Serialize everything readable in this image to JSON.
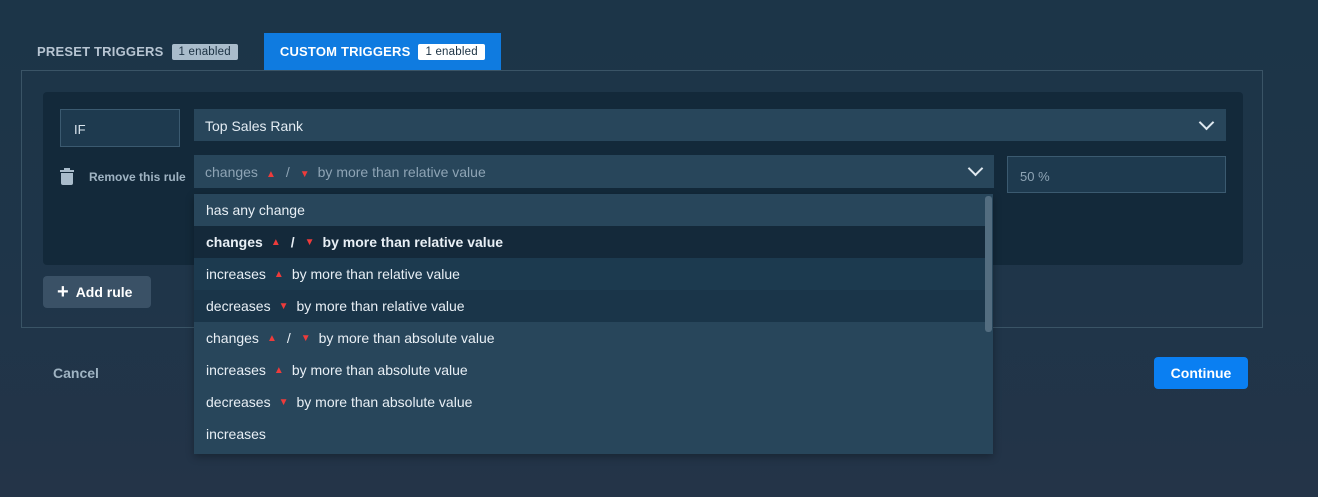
{
  "tabs": [
    {
      "label": "PRESET TRIGGERS",
      "badge": "1 enabled"
    },
    {
      "label": "CUSTOM TRIGGERS",
      "badge": "1 enabled"
    }
  ],
  "rule": {
    "if_label": "IF",
    "attribute": "Top Sales Rank",
    "condition": {
      "pre": "changes",
      "sep": "/",
      "post": "by more than relative value"
    },
    "value": "50 %",
    "remove_label": "Remove this rule"
  },
  "dropdown": {
    "options": [
      {
        "pre": "has any change",
        "sep": "",
        "post": ""
      },
      {
        "pre": "changes",
        "sep": "/",
        "post": "by more than relative value"
      },
      {
        "pre": "increases",
        "sep": "",
        "post": "by more than relative value"
      },
      {
        "pre": "decreases",
        "sep": "",
        "post": "by more than relative value"
      },
      {
        "pre": "changes",
        "sep": "/",
        "post": "by more than absolute value"
      },
      {
        "pre": "increases",
        "sep": "",
        "post": "by more than absolute value"
      },
      {
        "pre": "decreases",
        "sep": "",
        "post": "by more than absolute value"
      },
      {
        "pre": "increases",
        "sep": "",
        "post": ""
      }
    ],
    "selected_index": 1
  },
  "buttons": {
    "add_rule": "Add rule",
    "cancel": "Cancel",
    "continue": "Continue"
  },
  "icons": {
    "trash": "trash-icon",
    "plus": "plus-icon",
    "chevron": "chevron-down-icon",
    "up": "triangle-up-icon",
    "down": "triangle-down-icon"
  },
  "colors": {
    "accent": "#0a7ff2",
    "arrow": "#ee3b3b"
  }
}
